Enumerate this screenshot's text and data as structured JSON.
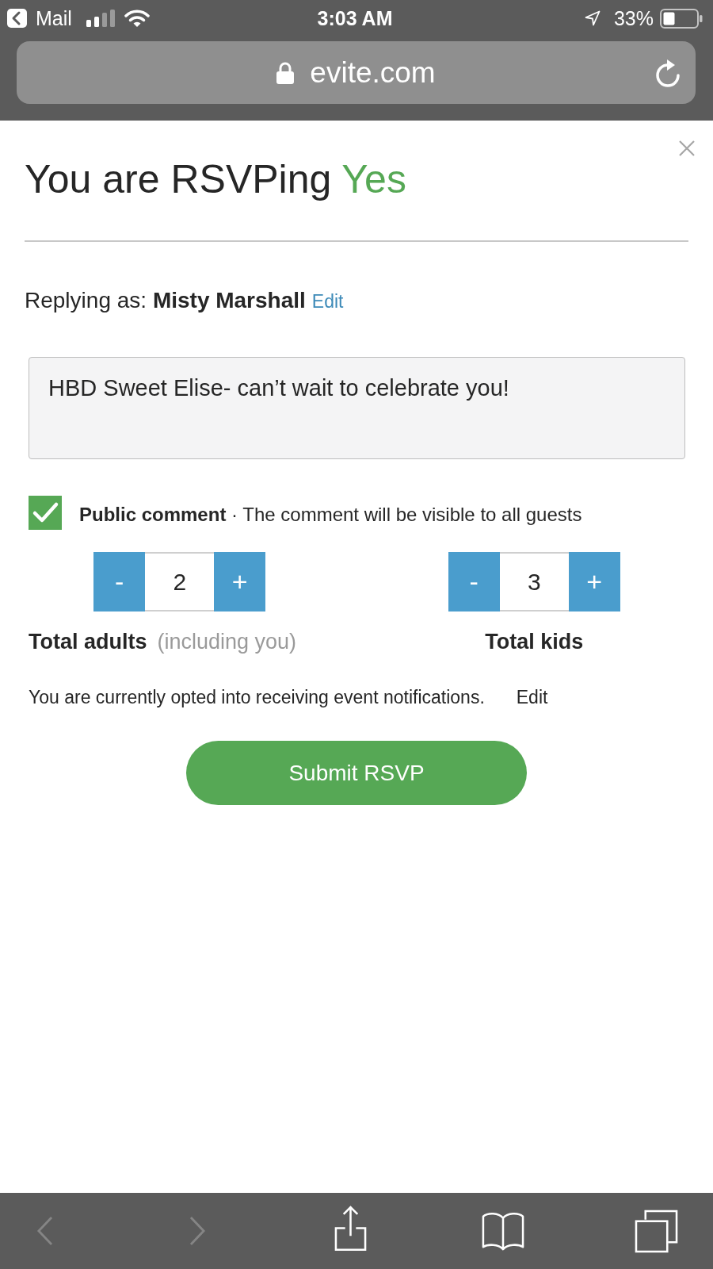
{
  "status_bar": {
    "back_app": "Mail",
    "time": "3:03 AM",
    "battery": "33%"
  },
  "address_bar": {
    "url": "evite.com"
  },
  "dialog": {
    "title": "You are RSVPing",
    "response": "Yes",
    "replying_as": "Replying as: **Misty Marshall**",
    "edit_link": "Edit",
    "comment": {
      "value": "HBD Sweet Elise- can’t wait to celebrate you!"
    },
    "public_comment": {
      "checked": true,
      "text": "**Public comment** · The comment will be visible to all guests"
    },
    "counters": [
      {
        "decrement": "-",
        "value": "2",
        "increment": "+",
        "label": "Total adults",
        "note": "(including you)"
      },
      {
        "decrement": "-",
        "value": "3",
        "increment": "+",
        "label": "Total kids"
      }
    ],
    "notifications": {
      "text": "You are currently opted into receiving event notifications.",
      "edit_link": "Edit"
    },
    "submit_button": "Submit RSVP"
  },
  "toolbar": {
    "items": [
      {
        "kind": "back",
        "disabled": true
      },
      {
        "kind": "forward",
        "disabled": true
      },
      {
        "kind": "share",
        "disabled": false
      },
      {
        "kind": "bookmarks",
        "disabled": false
      },
      {
        "kind": "tabs",
        "disabled": false
      }
    ]
  }
}
